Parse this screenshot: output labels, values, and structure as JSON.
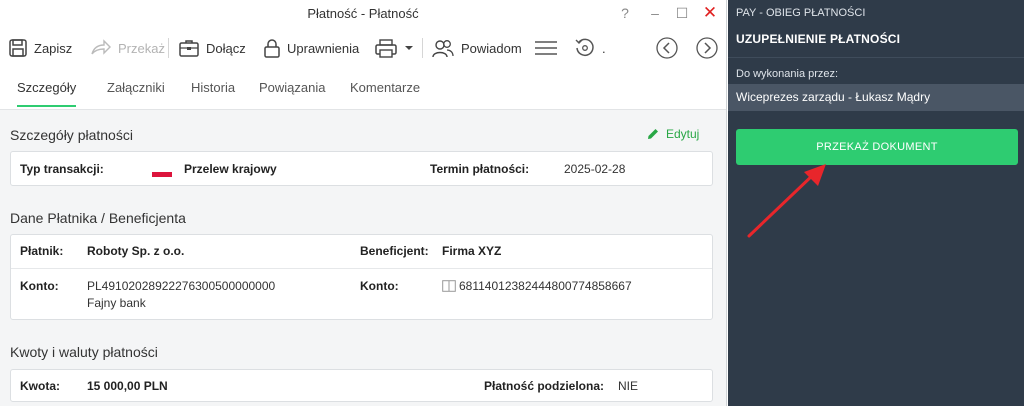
{
  "window": {
    "title": "Płatność - Płatność",
    "help": "?",
    "minimize": "–",
    "maximize": "☐",
    "close": "✕"
  },
  "toolbar": {
    "save": "Zapisz",
    "forward": "Przekaż",
    "attach": "Dołącz",
    "permissions": "Uprawnienia",
    "notify": "Powiadom",
    "history_dot": "."
  },
  "tabs": [
    "Szczegóły",
    "Załączniki",
    "Historia",
    "Powiązania",
    "Komentarze"
  ],
  "details": {
    "title": "Szczegóły płatności",
    "edit": "Edytuj",
    "transaction_type_label": "Typ transakcji:",
    "transaction_type_value": "Przelew krajowy",
    "due_label": "Termin płatności:",
    "due_value": "2025-02-28"
  },
  "parties": {
    "title": "Dane Płatnika / Beneficjenta",
    "payer_label": "Płatnik:",
    "payer_value": "Roboty Sp. z o.o.",
    "beneficiary_label": "Beneficjent:",
    "beneficiary_value": "Firma XYZ",
    "account_label_left": "Konto:",
    "account_left": "PL49102028922276300500000000",
    "bank_left": "Fajny bank",
    "account_label_right": "Konto:",
    "account_right": "68114012382444800774858667"
  },
  "amounts": {
    "title": "Kwoty i waluty płatności",
    "amount_label": "Kwota:",
    "amount_value": "15 000,00 PLN",
    "split_label": "Płatność podzielona:",
    "split_value": "NIE"
  },
  "panel": {
    "header": "PAY - OBIEG PŁATNOŚCI",
    "title": "UZUPEŁNIENIE PŁATNOŚCI",
    "assignee_label": "Do wykonania przez:",
    "assignee_value": "Wiceprezes zarządu - Łukasz Mądry",
    "action_button": "PRZEKAŻ DOKUMENT"
  },
  "colors": {
    "accent_green": "#2ecc71",
    "panel_bg": "#2f3b49",
    "flag_red": "#dc143c",
    "annotation_arrow": "#e8262b"
  }
}
